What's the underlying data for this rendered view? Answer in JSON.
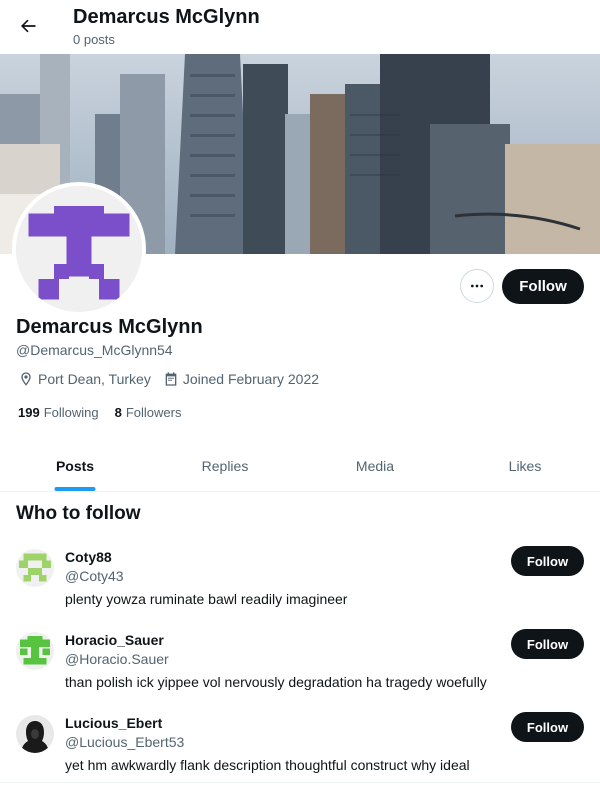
{
  "header": {
    "title": "Demarcus McGlynn",
    "subtitle": "0 posts"
  },
  "profile": {
    "name": "Demarcus McGlynn",
    "handle": "@Demarcus_McGlynn54",
    "location": "Port Dean, Turkey",
    "joined": "Joined February 2022",
    "following_count": "199",
    "following_label": "Following",
    "followers_count": "8",
    "followers_label": "Followers",
    "follow_label": "Follow",
    "avatar_color": "#7b4fc9"
  },
  "tabs": [
    {
      "label": "Posts",
      "active": true
    },
    {
      "label": "Replies"
    },
    {
      "label": "Media"
    },
    {
      "label": "Likes"
    }
  ],
  "who_to_follow": {
    "title": "Who to follow",
    "items": [
      {
        "name": "Coty88",
        "handle": "@Coty43",
        "bio": "plenty yowza ruminate bawl readily imagineer",
        "follow_label": "Follow",
        "avatar_color": "#9ed36a"
      },
      {
        "name": "Horacio_Sauer",
        "handle": "@Horacio.Sauer",
        "bio": "than polish ick yippee vol nervously degradation ha tragedy woefully",
        "follow_label": "Follow",
        "avatar_color": "#56c43e"
      },
      {
        "name": "Lucious_Ebert",
        "handle": "@Lucious_Ebert53",
        "bio": "yet hm awkwardly flank description thoughtful construct why ideal",
        "follow_label": "Follow",
        "avatar_color": "#1a1a1a"
      }
    ]
  }
}
